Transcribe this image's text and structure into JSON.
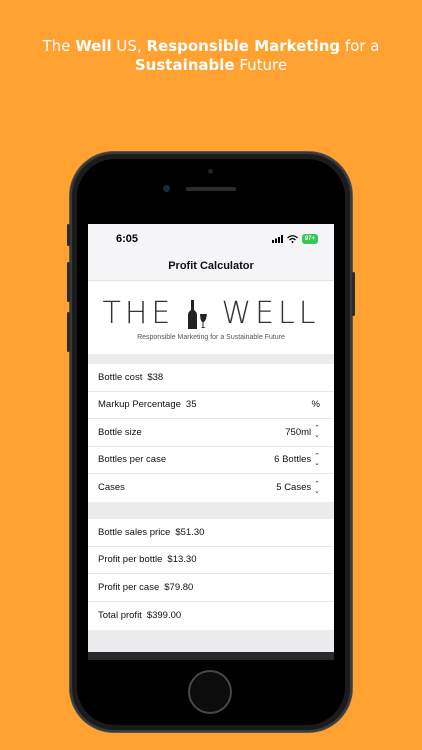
{
  "promo": {
    "part1": "The ",
    "part2": "Well",
    "part3": " US, ",
    "part4": "Responsible Marketing",
    "part5": " for a",
    "part6": "Sustainable",
    "part7": " Future"
  },
  "status": {
    "time": "6:05",
    "battery": "97+"
  },
  "nav": {
    "title": "Profit Calculator"
  },
  "logo": {
    "word1": "THE",
    "word2": "WELL",
    "tagline": "Responsible Marketing for a Sustainable Future"
  },
  "inputs": {
    "bottle_cost_label": "Bottle cost",
    "bottle_cost_value": "$38",
    "markup_label": "Markup Percentage",
    "markup_value": "35",
    "markup_unit": "%",
    "bottle_size_label": "Bottle size",
    "bottle_size_value": "750ml",
    "bottles_per_case_label": "Bottles per case",
    "bottles_per_case_value": "6 Bottles",
    "cases_label": "Cases",
    "cases_value": "5 Cases"
  },
  "results": {
    "sales_price_label": "Bottle sales price",
    "sales_price_value": "$51.30",
    "profit_bottle_label": "Profit per bottle",
    "profit_bottle_value": "$13.30",
    "profit_case_label": "Profit per case",
    "profit_case_value": "$79.80",
    "total_profit_label": "Total profit",
    "total_profit_value": "$399.00"
  },
  "colors": {
    "background": "#FFA231",
    "battery": "#34C759"
  }
}
